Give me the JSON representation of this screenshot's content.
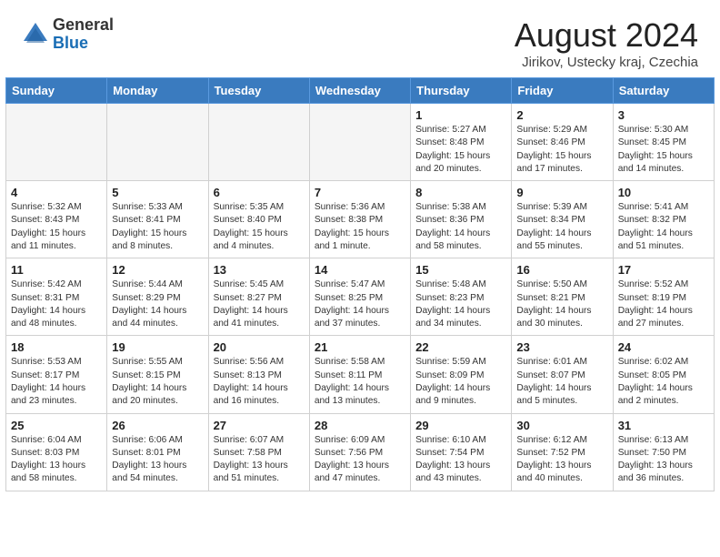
{
  "header": {
    "logo_line1": "General",
    "logo_line2": "Blue",
    "month_title": "August 2024",
    "subtitle": "Jirikov, Ustecky kraj, Czechia"
  },
  "calendar": {
    "weekdays": [
      "Sunday",
      "Monday",
      "Tuesday",
      "Wednesday",
      "Thursday",
      "Friday",
      "Saturday"
    ],
    "weeks": [
      [
        {
          "day": "",
          "info": ""
        },
        {
          "day": "",
          "info": ""
        },
        {
          "day": "",
          "info": ""
        },
        {
          "day": "",
          "info": ""
        },
        {
          "day": "1",
          "info": "Sunrise: 5:27 AM\nSunset: 8:48 PM\nDaylight: 15 hours\nand 20 minutes."
        },
        {
          "day": "2",
          "info": "Sunrise: 5:29 AM\nSunset: 8:46 PM\nDaylight: 15 hours\nand 17 minutes."
        },
        {
          "day": "3",
          "info": "Sunrise: 5:30 AM\nSunset: 8:45 PM\nDaylight: 15 hours\nand 14 minutes."
        }
      ],
      [
        {
          "day": "4",
          "info": "Sunrise: 5:32 AM\nSunset: 8:43 PM\nDaylight: 15 hours\nand 11 minutes."
        },
        {
          "day": "5",
          "info": "Sunrise: 5:33 AM\nSunset: 8:41 PM\nDaylight: 15 hours\nand 8 minutes."
        },
        {
          "day": "6",
          "info": "Sunrise: 5:35 AM\nSunset: 8:40 PM\nDaylight: 15 hours\nand 4 minutes."
        },
        {
          "day": "7",
          "info": "Sunrise: 5:36 AM\nSunset: 8:38 PM\nDaylight: 15 hours\nand 1 minute."
        },
        {
          "day": "8",
          "info": "Sunrise: 5:38 AM\nSunset: 8:36 PM\nDaylight: 14 hours\nand 58 minutes."
        },
        {
          "day": "9",
          "info": "Sunrise: 5:39 AM\nSunset: 8:34 PM\nDaylight: 14 hours\nand 55 minutes."
        },
        {
          "day": "10",
          "info": "Sunrise: 5:41 AM\nSunset: 8:32 PM\nDaylight: 14 hours\nand 51 minutes."
        }
      ],
      [
        {
          "day": "11",
          "info": "Sunrise: 5:42 AM\nSunset: 8:31 PM\nDaylight: 14 hours\nand 48 minutes."
        },
        {
          "day": "12",
          "info": "Sunrise: 5:44 AM\nSunset: 8:29 PM\nDaylight: 14 hours\nand 44 minutes."
        },
        {
          "day": "13",
          "info": "Sunrise: 5:45 AM\nSunset: 8:27 PM\nDaylight: 14 hours\nand 41 minutes."
        },
        {
          "day": "14",
          "info": "Sunrise: 5:47 AM\nSunset: 8:25 PM\nDaylight: 14 hours\nand 37 minutes."
        },
        {
          "day": "15",
          "info": "Sunrise: 5:48 AM\nSunset: 8:23 PM\nDaylight: 14 hours\nand 34 minutes."
        },
        {
          "day": "16",
          "info": "Sunrise: 5:50 AM\nSunset: 8:21 PM\nDaylight: 14 hours\nand 30 minutes."
        },
        {
          "day": "17",
          "info": "Sunrise: 5:52 AM\nSunset: 8:19 PM\nDaylight: 14 hours\nand 27 minutes."
        }
      ],
      [
        {
          "day": "18",
          "info": "Sunrise: 5:53 AM\nSunset: 8:17 PM\nDaylight: 14 hours\nand 23 minutes."
        },
        {
          "day": "19",
          "info": "Sunrise: 5:55 AM\nSunset: 8:15 PM\nDaylight: 14 hours\nand 20 minutes."
        },
        {
          "day": "20",
          "info": "Sunrise: 5:56 AM\nSunset: 8:13 PM\nDaylight: 14 hours\nand 16 minutes."
        },
        {
          "day": "21",
          "info": "Sunrise: 5:58 AM\nSunset: 8:11 PM\nDaylight: 14 hours\nand 13 minutes."
        },
        {
          "day": "22",
          "info": "Sunrise: 5:59 AM\nSunset: 8:09 PM\nDaylight: 14 hours\nand 9 minutes."
        },
        {
          "day": "23",
          "info": "Sunrise: 6:01 AM\nSunset: 8:07 PM\nDaylight: 14 hours\nand 5 minutes."
        },
        {
          "day": "24",
          "info": "Sunrise: 6:02 AM\nSunset: 8:05 PM\nDaylight: 14 hours\nand 2 minutes."
        }
      ],
      [
        {
          "day": "25",
          "info": "Sunrise: 6:04 AM\nSunset: 8:03 PM\nDaylight: 13 hours\nand 58 minutes."
        },
        {
          "day": "26",
          "info": "Sunrise: 6:06 AM\nSunset: 8:01 PM\nDaylight: 13 hours\nand 54 minutes."
        },
        {
          "day": "27",
          "info": "Sunrise: 6:07 AM\nSunset: 7:58 PM\nDaylight: 13 hours\nand 51 minutes."
        },
        {
          "day": "28",
          "info": "Sunrise: 6:09 AM\nSunset: 7:56 PM\nDaylight: 13 hours\nand 47 minutes."
        },
        {
          "day": "29",
          "info": "Sunrise: 6:10 AM\nSunset: 7:54 PM\nDaylight: 13 hours\nand 43 minutes."
        },
        {
          "day": "30",
          "info": "Sunrise: 6:12 AM\nSunset: 7:52 PM\nDaylight: 13 hours\nand 40 minutes."
        },
        {
          "day": "31",
          "info": "Sunrise: 6:13 AM\nSunset: 7:50 PM\nDaylight: 13 hours\nand 36 minutes."
        }
      ]
    ]
  }
}
